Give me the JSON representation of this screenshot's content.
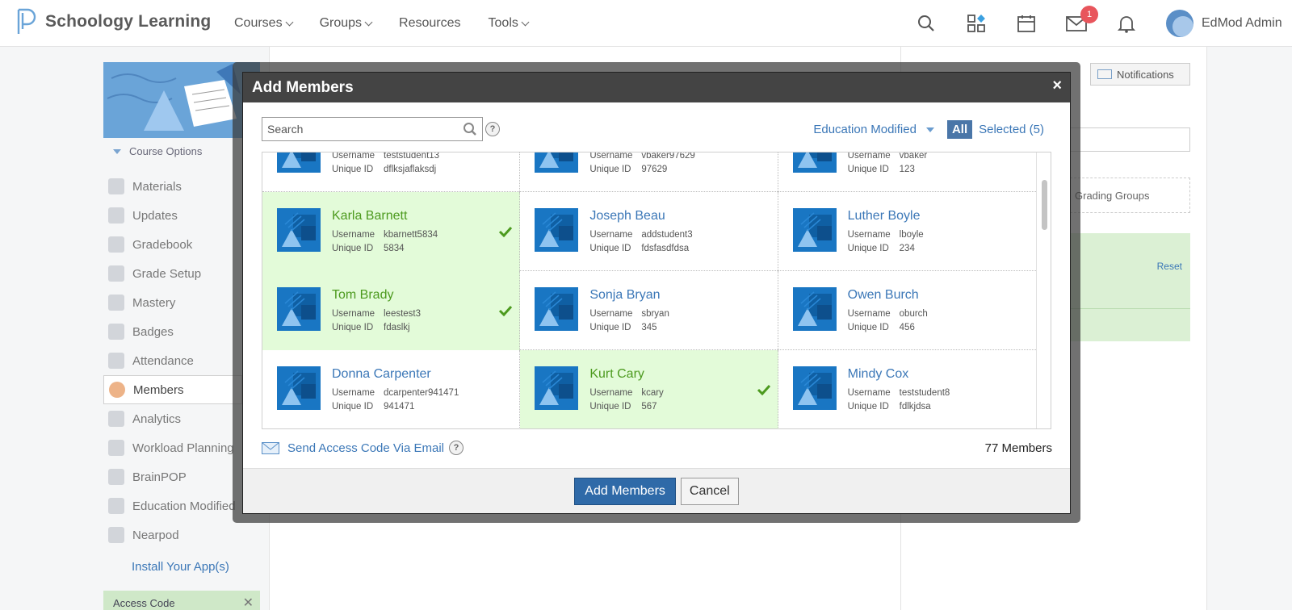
{
  "app": {
    "name": "Schoology Learning"
  },
  "nav": {
    "items": [
      {
        "label": "Courses",
        "dropdown": true
      },
      {
        "label": "Groups",
        "dropdown": true
      },
      {
        "label": "Resources",
        "dropdown": false
      },
      {
        "label": "Tools",
        "dropdown": true
      }
    ],
    "mail_badge": "1",
    "user_name": "EdMod Admin"
  },
  "sidebar": {
    "course_options": "Course Options",
    "items": [
      {
        "label": "Materials",
        "icon": "materials-icon"
      },
      {
        "label": "Updates",
        "icon": "updates-icon"
      },
      {
        "label": "Gradebook",
        "icon": "gradebook-icon"
      },
      {
        "label": "Grade Setup",
        "icon": "grade-setup-icon"
      },
      {
        "label": "Mastery",
        "icon": "mastery-icon"
      },
      {
        "label": "Badges",
        "icon": "badges-icon"
      },
      {
        "label": "Attendance",
        "icon": "attendance-icon"
      },
      {
        "label": "Members",
        "icon": "members-icon",
        "active": true
      },
      {
        "label": "Analytics",
        "icon": "analytics-icon"
      },
      {
        "label": "Workload Planning",
        "icon": "workload-icon"
      },
      {
        "label": "BrainPOP",
        "icon": "brainpop-icon"
      },
      {
        "label": "Education Modified",
        "icon": "education-modified-icon"
      },
      {
        "label": "Nearpod",
        "icon": "nearpod-icon"
      }
    ],
    "install_link": "Install Your App(s)",
    "access_code": "Access Code"
  },
  "background": {
    "notifications_button": "Notifications",
    "grading_groups": "Grading Groups",
    "reset": "Reset"
  },
  "modal": {
    "title": "Add Members",
    "close": "×",
    "search_placeholder": "Search",
    "filter_label": "Education Modified",
    "all_label": "All",
    "selected_label": "Selected (5)",
    "username_label": "Username",
    "uniqueid_label": "Unique ID",
    "rows": [
      [
        {
          "name": "",
          "username": "teststudent13",
          "uid": "dflksjaflaksdj",
          "selected": false
        },
        {
          "name": "",
          "username": "vbaker97629",
          "uid": "97629",
          "selected": false
        },
        {
          "name": "",
          "username": "vbaker",
          "uid": "123",
          "selected": false
        }
      ],
      [
        {
          "name": "Karla Barnett",
          "username": "kbarnett5834",
          "uid": "5834",
          "selected": true
        },
        {
          "name": "Joseph Beau",
          "username": "addstudent3",
          "uid": "fdsfasdfdsa",
          "selected": false
        },
        {
          "name": "Luther Boyle",
          "username": "lboyle",
          "uid": "234",
          "selected": false
        }
      ],
      [
        {
          "name": "Tom Brady",
          "username": "leestest3",
          "uid": "fdaslkj",
          "selected": true
        },
        {
          "name": "Sonja Bryan",
          "username": "sbryan",
          "uid": "345",
          "selected": false
        },
        {
          "name": "Owen Burch",
          "username": "oburch",
          "uid": "456",
          "selected": false
        }
      ],
      [
        {
          "name": "Donna Carpenter",
          "username": "dcarpenter941471",
          "uid": "941471",
          "selected": false
        },
        {
          "name": "Kurt Cary",
          "username": "kcary",
          "uid": "567",
          "selected": true
        },
        {
          "name": "Mindy Cox",
          "username": "teststudent8",
          "uid": "fdlkjdsa",
          "selected": false
        }
      ]
    ],
    "send_access": "Send Access Code Via Email",
    "member_count": "77 Members",
    "add_button": "Add Members",
    "cancel_button": "Cancel"
  }
}
